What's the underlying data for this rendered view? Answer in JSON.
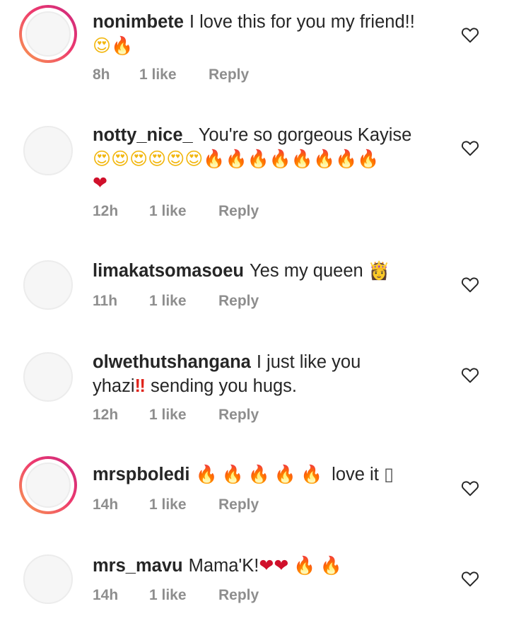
{
  "comments": [
    {
      "username": "nonimbete",
      "text": "I love this for you my friend!!",
      "emoji_line": [
        "heart-eyes",
        "fire"
      ],
      "time": "8h",
      "likes": "1 like",
      "reply": "Reply",
      "story_ring": true
    },
    {
      "username": "notty_nice_",
      "text": "You're so gorgeous Kayise",
      "emoji_line": [
        "heart-eyes",
        "heart-eyes",
        "heart-eyes",
        "heart-eyes",
        "heart-eyes",
        "heart-eyes",
        "fire",
        "fire",
        "fire",
        "fire",
        "fire",
        "fire",
        "fire",
        "fire"
      ],
      "emoji_line2": [
        "red-heart"
      ],
      "time": "12h",
      "likes": "1 like",
      "reply": "Reply",
      "story_ring": false
    },
    {
      "username": "limakatsomasoeu",
      "text": "Yes my queen",
      "emoji_line": [
        "princess"
      ],
      "time": "11h",
      "likes": "1 like",
      "reply": "Reply",
      "story_ring": false
    },
    {
      "username": "olwethutshangana",
      "text": "I just like you",
      "text2": "yhazi",
      "text3": "sending you hugs.",
      "emoji_line": [
        "double-exclamation"
      ],
      "time": "12h",
      "likes": "1 like",
      "reply": "Reply",
      "story_ring": false
    },
    {
      "username": "mrspboledi",
      "text": "love it",
      "emoji_line": [
        "fire",
        "fire",
        "fire",
        "fire",
        "fire"
      ],
      "tail_glyph": "▯",
      "time": "14h",
      "likes": "1 like",
      "reply": "Reply",
      "story_ring": true
    },
    {
      "username": "mrs_mavu",
      "text": "Mama'K!",
      "emoji_line": [
        "red-heart",
        "red-heart",
        "fire",
        "fire"
      ],
      "time": "14h",
      "likes": "1 like",
      "reply": "Reply",
      "story_ring": false
    }
  ],
  "icons": {
    "like": "heart-outline-icon"
  },
  "colors": {
    "text": "#262626",
    "meta": "#8e8e8e",
    "story_ring_start": "#f9a04f",
    "story_ring_end": "#c9287f"
  }
}
